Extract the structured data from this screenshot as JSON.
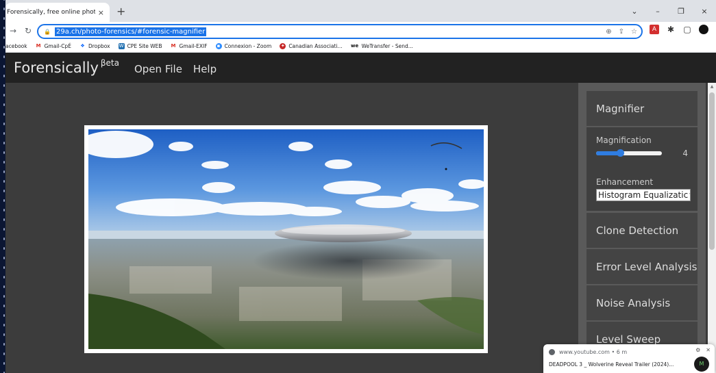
{
  "browser": {
    "tab_title": "Forensically, free online photo fo",
    "tab_close": "×",
    "new_tab": "+",
    "win_min": "–",
    "win_max": "❐",
    "win_close": "×",
    "win_chevron": "⌄",
    "url": "29a.ch/photo-forensics/#forensic-magnifier",
    "bookmarks": [
      {
        "label": "acebook",
        "icon": "facebook-icon"
      },
      {
        "label": "Gmail-CpÉ",
        "icon": "gmail-icon"
      },
      {
        "label": "Dropbox",
        "icon": "dropbox-icon"
      },
      {
        "label": "CPE Site WEB",
        "icon": "wordpress-icon"
      },
      {
        "label": "Gmail-EXIF",
        "icon": "gmail-icon"
      },
      {
        "label": "Connexion - Zoom",
        "icon": "zoom-icon"
      },
      {
        "label": "Canadian Associati...",
        "icon": "maple-leaf-icon"
      },
      {
        "label": "WeTransfer - Send...",
        "icon": "wetransfer-icon"
      }
    ]
  },
  "app": {
    "brand": "Forensically",
    "brand_sup": "βeta",
    "menu": [
      "Open File",
      "Help"
    ]
  },
  "sidebar": {
    "magnifier": {
      "title": "Magnifier",
      "magnification_label": "Magnification",
      "magnification_value": "4",
      "magnification_fraction": 0.35,
      "enhancement_label": "Enhancement",
      "enhancement_value": "Histogram Equalizatic"
    },
    "panels": [
      "Clone Detection",
      "Error Level Analysis",
      "Noise Analysis",
      "Level Sweep"
    ]
  },
  "toast": {
    "source": "www.youtube.com • 6 m",
    "video": "DEADPOOL 3 _ Wolverine Reveal Trailer (2024)..."
  },
  "colors": {
    "accent": "#1a73e8",
    "slider": "#2f7de1"
  }
}
